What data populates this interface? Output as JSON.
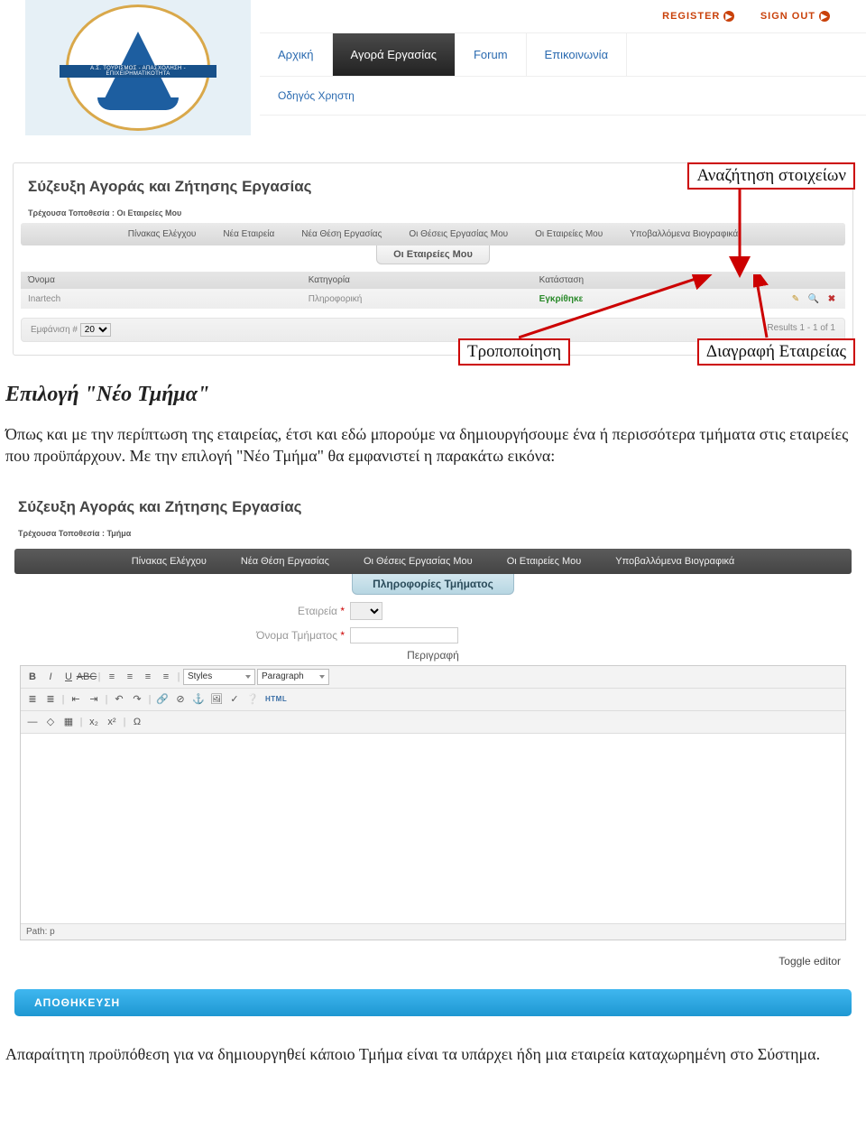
{
  "header": {
    "logo_label": "Α.Σ. ΤΟΥΡΙΣΜΟΣ - ΑΠΑΣΧΟΛΗΣΗ - ΕΠΙΧΕΙΡΗΜΑΤΙΚΟΤΗΤΑ",
    "top_links": {
      "register": "REGISTER",
      "sign_out": "SIGN OUT"
    },
    "nav": {
      "home": "Αρχική",
      "market": "Αγορά Εργασίας",
      "forum": "Forum",
      "contact": "Επικοινωνία",
      "guide": "Οδηγός Χρηστη"
    }
  },
  "shot1": {
    "title": "Σύζευξη Αγοράς και Ζήτησης Εργασίας",
    "crumb": "Τρέχουσα Τοποθεσία : Οι Εταιρείες Μου",
    "tabs": {
      "dashboard": "Πίνακας Ελέγχου",
      "new_company": "Νέα Εταιρεία",
      "new_job": "Νέα Θέση Εργασίας",
      "my_jobs": "Οι Θέσεις Εργασίας Μου",
      "my_companies": "Οι Εταιρείες Μου",
      "cvs": "Υποβαλλόμενα Βιογραφικά"
    },
    "subtab": "Οι Εταιρείες Μου",
    "columns": {
      "name": "Όνομα",
      "category": "Κατηγορία",
      "status": "Κατάσταση"
    },
    "row": {
      "name": "Inartech",
      "category": "Πληροφορική",
      "status": "Εγκρίθηκε"
    },
    "show_label": "Εμφάνιση #",
    "show_value": "20",
    "results": "Results 1 - 1 of 1"
  },
  "callouts": {
    "search": "Αναζήτηση στοιχείων",
    "modify": "Τροποποίηση",
    "delete": "Διαγραφή Εταιρείας"
  },
  "body": {
    "heading": "Επιλογή \"Νέο Τμήμα\"",
    "p1": "Όπως και με την περίπτωση της εταιρείας, έτσι και εδώ μπορούμε να δημιουργήσουμε ένα ή περισσότερα τμήματα στις εταιρείες που προϋπάρχουν. Με την επιλογή \"Νέο Τμήμα\" θα εμφανιστεί η παρακάτω εικόνα:",
    "p2": "Απαραίτητη προϋπόθεση για να δημιουργηθεί κάποιο Τμήμα είναι τα υπάρχει ήδη μια εταιρεία καταχωρημένη στο Σύστημα."
  },
  "shot2": {
    "title": "Σύζευξη Αγοράς και Ζήτησης Εργασίας",
    "crumb": "Τρέχουσα Τοποθεσία : Τμήμα",
    "tabs": {
      "dashboard": "Πίνακας Ελέγχου",
      "new_job": "Νέα Θέση Εργασίας",
      "my_jobs": "Οι Θέσεις Εργασίας Μου",
      "my_companies": "Οι Εταιρείες Μου",
      "cvs": "Υποβαλλόμενα Βιογραφικά"
    },
    "subtab": "Πληροφορίες Τμήματος",
    "form": {
      "company_label": "Εταιρεία",
      "dept_label": "Όνομα Τμήματος",
      "desc_label": "Περιγραφή"
    },
    "editor": {
      "styles": "Styles",
      "paragraph": "Paragraph",
      "html": "HTML",
      "path": "Path: p"
    },
    "toggle": "Toggle editor",
    "save": "ΑΠΟΘΗΚΕΥΣΗ"
  }
}
